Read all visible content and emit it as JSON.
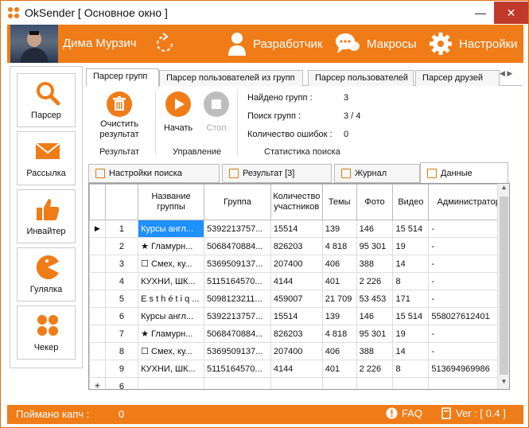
{
  "window": {
    "title": "OkSender [ Основное окно ]",
    "minimize": "—",
    "maximize": "☐",
    "close": "✕",
    "accent": "#f07c18"
  },
  "topbar": {
    "user_name": "Дима Мурзич",
    "developer": "Разработчик",
    "macros": "Макросы",
    "settings": "Настройки"
  },
  "sidebar": {
    "items": [
      {
        "label": "Парсер",
        "icon": "search-icon"
      },
      {
        "label": "Рассылка",
        "icon": "envelope-icon"
      },
      {
        "label": "Инвайтер",
        "icon": "thumbs-up-icon"
      },
      {
        "label": "Гулялка",
        "icon": "pacman-icon"
      },
      {
        "label": "Чекер",
        "icon": "four-dots-icon"
      }
    ]
  },
  "main_tabs": [
    "Парсер групп",
    "Парсер пользователей из групп",
    "Парсер пользователей",
    "Парсер друзей"
  ],
  "ribbon": {
    "clear_label": "Очистить результат",
    "clear_line1": "Очистить",
    "clear_line2": "результат",
    "start_label": "Начать",
    "stop_label": "Стоп",
    "group_result": "Результат",
    "group_control": "Управление",
    "group_stats": "Статистика поиска",
    "stats": [
      {
        "label": "Найдено групп :",
        "value": "3"
      },
      {
        "label": "Поиск групп :",
        "value": "3 / 4"
      },
      {
        "label": "Количество ошибок :",
        "value": "0"
      }
    ]
  },
  "sub_tabs": [
    "Настройки поиска",
    "Результат [3]",
    "Журнал",
    "Данные"
  ],
  "table": {
    "columns": [
      "Название группы",
      "Группа",
      "Количество участников",
      "Темы",
      "Фото",
      "Видео",
      "Администратор"
    ],
    "col_name_line1": "Название",
    "col_name_line2": "группы",
    "col_count_line1": "Количество",
    "col_count_line2": "участников",
    "rows": [
      {
        "n": "1",
        "name": "Курсы англ...",
        "group": "5392213757...",
        "members": "15514",
        "topics": "139",
        "photo": "146",
        "video": "15 514",
        "admin": "-"
      },
      {
        "n": "2",
        "name": "★ Гламурн...",
        "group": "5068470884...",
        "members": "826203",
        "topics": "4 818",
        "photo": "95 301",
        "video": "19",
        "admin": "-"
      },
      {
        "n": "3",
        "name": "☐ Смех, ку...",
        "group": "5369509137...",
        "members": "207400",
        "topics": "406",
        "photo": "388",
        "video": "14",
        "admin": "-"
      },
      {
        "n": "4",
        "name": "КУХНИ, ШК...",
        "group": "5115164570...",
        "members": "4144",
        "topics": "401",
        "photo": "2 226",
        "video": "8",
        "admin": "-"
      },
      {
        "n": "5",
        "name": "E s t h é t i q ...",
        "group": "5098123211...",
        "members": "459007",
        "topics": "21 709",
        "photo": "53 453",
        "video": "171",
        "admin": "-"
      },
      {
        "n": "6",
        "name": "Курсы англ...",
        "group": "5392213757...",
        "members": "15514",
        "topics": "139",
        "photo": "146",
        "video": "15 514",
        "admin": "558027612401"
      },
      {
        "n": "7",
        "name": "★ Гламурн...",
        "group": "5068470884...",
        "members": "826203",
        "topics": "4 818",
        "photo": "95 301",
        "video": "19",
        "admin": "-"
      },
      {
        "n": "8",
        "name": "☐ Смех, ку...",
        "group": "5369509137...",
        "members": "207400",
        "topics": "406",
        "photo": "388",
        "video": "14",
        "admin": "-"
      },
      {
        "n": "9",
        "name": "КУХНИ, ШК...",
        "group": "5115164570...",
        "members": "4144",
        "topics": "401",
        "photo": "2 226",
        "video": "8",
        "admin": "513694969986"
      }
    ],
    "new_row_n": "6",
    "current_marker": "▶",
    "new_marker": "✳"
  },
  "statusbar": {
    "captcha_label": "Поймано капч :",
    "captcha_value": "0",
    "faq": "FAQ",
    "version": "Ver : [ 0.4 ]"
  }
}
